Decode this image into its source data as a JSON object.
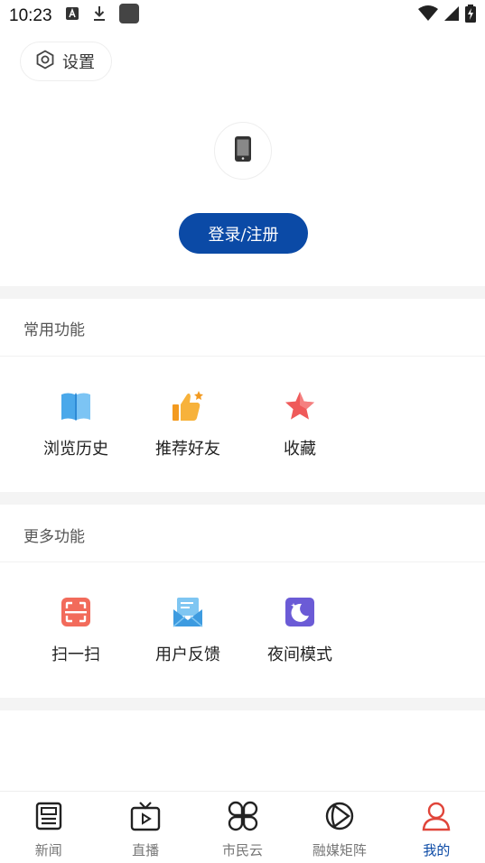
{
  "status_bar": {
    "time": "10:23"
  },
  "header": {
    "settings_label": "设置"
  },
  "account": {
    "login_label": "登录/注册"
  },
  "common_functions": {
    "title": "常用功能",
    "items": [
      {
        "label": "浏览历史",
        "icon": "book-icon"
      },
      {
        "label": "推荐好友",
        "icon": "thumbs-up-icon"
      },
      {
        "label": "收藏",
        "icon": "star-icon"
      }
    ]
  },
  "more_functions": {
    "title": "更多功能",
    "items": [
      {
        "label": "扫一扫",
        "icon": "scan-icon"
      },
      {
        "label": "用户反馈",
        "icon": "feedback-mail-icon"
      },
      {
        "label": "夜间模式",
        "icon": "moon-icon"
      }
    ]
  },
  "tabbar": {
    "items": [
      {
        "label": "新闻",
        "icon": "news-icon"
      },
      {
        "label": "直播",
        "icon": "tv-play-icon"
      },
      {
        "label": "市民云",
        "icon": "clover-grid-icon"
      },
      {
        "label": "融媒矩阵",
        "icon": "matrix-icon"
      },
      {
        "label": "我的",
        "icon": "user-icon"
      }
    ],
    "active_index": 4
  },
  "colors": {
    "primary": "#0b4aa6",
    "active_tab_icon": "#e0453a",
    "tab_inactive": "#777777",
    "section_band": "#f4f4f4"
  }
}
